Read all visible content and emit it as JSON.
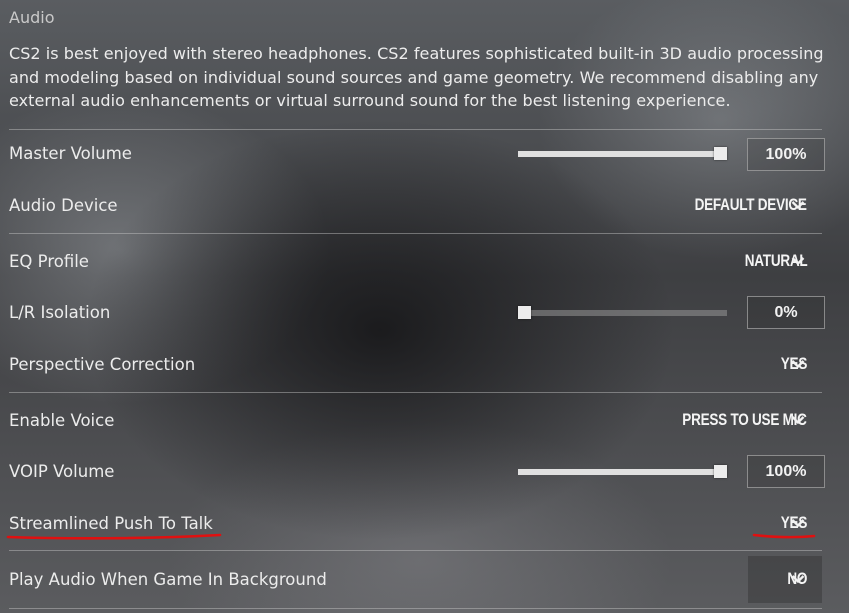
{
  "section": {
    "title": "Audio"
  },
  "description": "CS2 is best enjoyed with stereo headphones. CS2 features sophisticated built-in 3D audio processing and modeling based on individual sound sources and game geometry. We recommend disabling any external audio enhancements or virtual surround sound for the best listening experience.",
  "settings": {
    "master_volume": {
      "label": "Master Volume",
      "value_text": "100%",
      "level": 1.0
    },
    "audio_device": {
      "label": "Audio Device",
      "value": "DEFAULT DEVICE"
    },
    "eq_profile": {
      "label": "EQ Profile",
      "value": "NATURAL"
    },
    "lr_isolation": {
      "label": "L/R Isolation",
      "value_text": "0%",
      "level": 0.0
    },
    "perspective_correction": {
      "label": "Perspective Correction",
      "value": "YES"
    },
    "enable_voice": {
      "label": "Enable Voice",
      "value": "PRESS TO USE MIC"
    },
    "voip_volume": {
      "label": "VOIP Volume",
      "value_text": "100%",
      "level": 1.0
    },
    "streamlined_ptt": {
      "label": "Streamlined Push To Talk",
      "value": "YES"
    },
    "play_audio_background": {
      "label": "Play Audio When Game In Background",
      "value": "NO"
    }
  },
  "icons": {
    "dropdown": "chevron-down-icon"
  },
  "colors": {
    "annotation": "#e01010"
  }
}
